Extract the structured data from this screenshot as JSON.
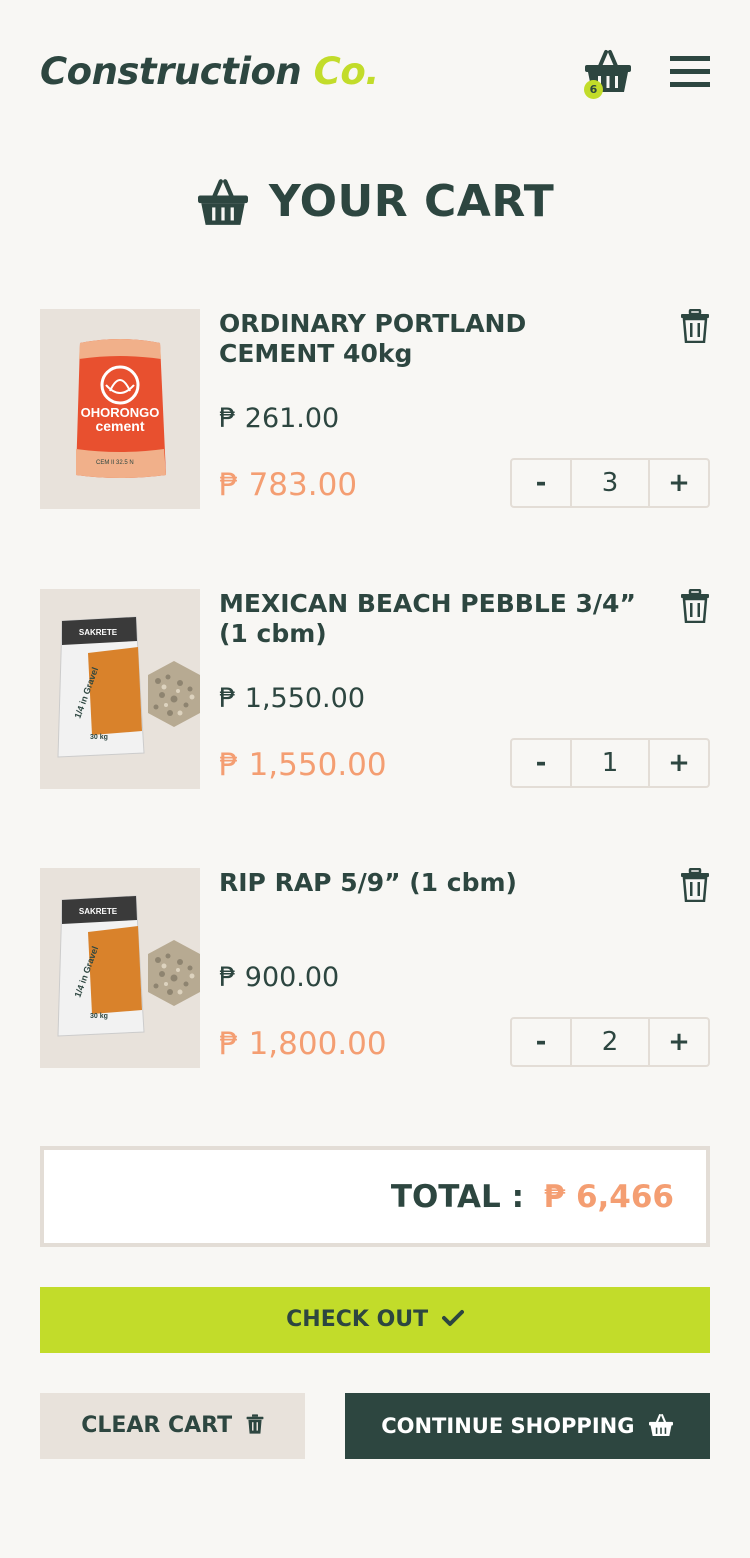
{
  "header": {
    "logo_brand": "Construction",
    "logo_suffix": "Co.",
    "cart_count": "6"
  },
  "page_title": "YOUR CART",
  "currency_symbol": "₱",
  "items": [
    {
      "name": "ORDINARY PORTLAND CEMENT 40kg",
      "unit_price": "₱ 261.00",
      "subtotal": "₱ 783.00",
      "quantity": "3",
      "image": "cement-bag",
      "bag_brand": "OHORONGO",
      "bag_product": "cement",
      "bag_grade": "CEM II 32.5 N"
    },
    {
      "name": "MEXICAN BEACH PEBBLE 3/4” (1 cbm)",
      "unit_price": "₱ 1,550.00",
      "subtotal": "₱ 1,550.00",
      "quantity": "1",
      "image": "gravel-bag",
      "bag_brand": "SAKRETE",
      "bag_product": "1/4 in Gravel",
      "bag_weight": "30 kg"
    },
    {
      "name": "RIP RAP 5/9” (1 cbm)",
      "unit_price": "₱ 900.00",
      "subtotal": "₱ 1,800.00",
      "quantity": "2",
      "image": "gravel-bag",
      "bag_brand": "SAKRETE",
      "bag_product": "1/4 in Gravel",
      "bag_weight": "30 kg"
    }
  ],
  "qty_controls": {
    "minus": "-",
    "plus": "+"
  },
  "total": {
    "label": "TOTAL :",
    "value": "₱ 6,466"
  },
  "buttons": {
    "checkout": "CHECK OUT",
    "clear": "CLEAR CART",
    "continue": "CONTINUE SHOPPING"
  },
  "colors": {
    "primary": "#2d4640",
    "accent": "#c2dc2a",
    "price": "#f49e72",
    "background": "#f8f7f4",
    "muted": "#e8e2db"
  },
  "icons": [
    "basket-icon",
    "menu-icon",
    "trash-icon",
    "check-icon"
  ]
}
